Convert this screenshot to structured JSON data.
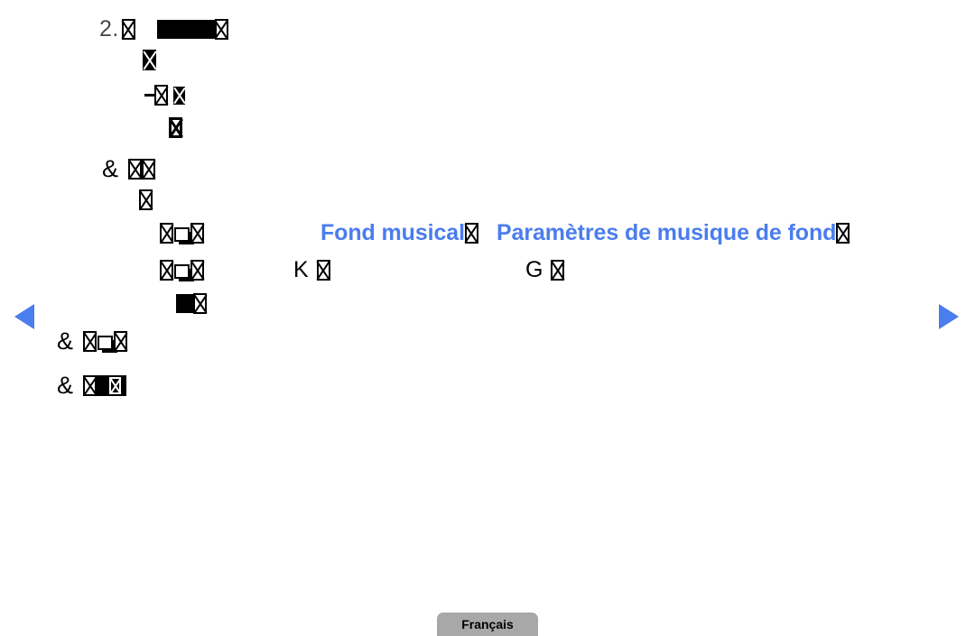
{
  "page": {
    "language_button": "Français",
    "accent_color": "#4a7dee",
    "text_color": "#000000",
    "background_color": "#ffffff",
    "button_color": "#a8a8a8"
  },
  "navigation": {
    "prev_label": "◀",
    "next_label": "▶"
  },
  "content": {
    "step_number": "2.",
    "glyph_note": "unsupported characters render as missing-glyph boxes",
    "rows": [
      {
        "id": "step-2-heading",
        "marker": "2.",
        "tokens": [
          "tofu",
          "space",
          "block",
          "block",
          "block",
          "tofu"
        ]
      },
      {
        "id": "step-2-line-2",
        "marker": "",
        "tokens": [
          "tofu-filled"
        ]
      },
      {
        "id": "step-2-line-3",
        "marker": "",
        "tokens": [
          "dash",
          "tofu",
          "tofu-filled"
        ]
      },
      {
        "id": "step-2-line-4",
        "marker": "",
        "tokens": [
          "tofu-double"
        ]
      },
      {
        "id": "note-1",
        "marker": "&",
        "tokens": [
          "tofu",
          "tofu"
        ]
      },
      {
        "id": "note-1-line-2",
        "marker": "",
        "tokens": [
          "tofu"
        ]
      },
      {
        "id": "option-row-1",
        "marker": "",
        "tokens": [
          "tofu",
          "white-square",
          "tofu"
        ],
        "label_blue_1": "Fond musical",
        "label_blue_2": "Paramètres de musique de fond"
      },
      {
        "id": "option-row-2",
        "marker": "",
        "tokens": [
          "tofu",
          "white-square",
          "tofu"
        ],
        "label_left": "K",
        "label_right": "G"
      },
      {
        "id": "option-row-3",
        "marker": "",
        "tokens": [
          "block",
          "tofu"
        ]
      },
      {
        "id": "note-2",
        "marker": "&",
        "tokens": [
          "tofu",
          "white-square",
          "tofu"
        ]
      },
      {
        "id": "note-3",
        "marker": "&",
        "tokens": [
          "tofu",
          "inverse-block-tofu"
        ]
      }
    ],
    "labels": {
      "fond_musical": "Fond musical",
      "parametres_musique": "Paramètres de musique de fond",
      "key_k": "K",
      "key_g": "G"
    }
  }
}
